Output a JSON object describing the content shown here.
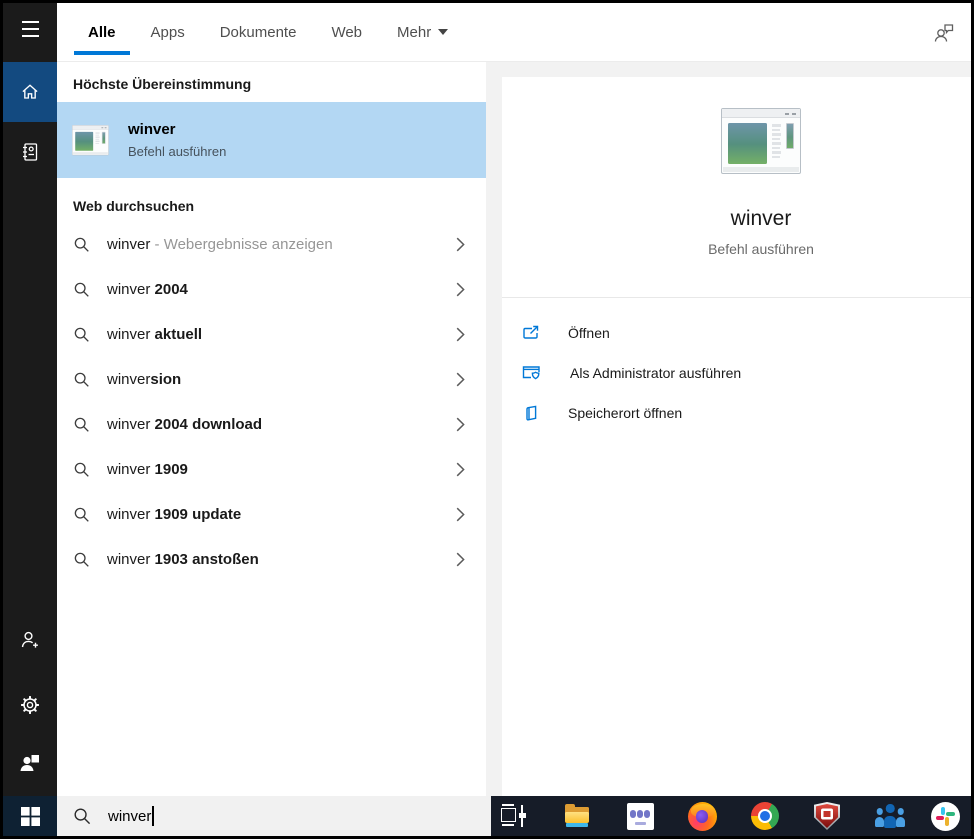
{
  "tabs": {
    "items": [
      "Alle",
      "Apps",
      "Dokumente",
      "Web",
      "Mehr"
    ],
    "active": "Alle"
  },
  "results": {
    "best_header": "Höchste Übereinstimmung",
    "best": {
      "title": "winver",
      "subtitle": "Befehl ausführen"
    },
    "web_header": "Web durchsuchen",
    "suggestions": [
      {
        "prefix": "winver",
        "suffix": " - Webergebnisse anzeigen",
        "style": "gray"
      },
      {
        "prefix": "winver",
        "suffix": " 2004",
        "style": "bold"
      },
      {
        "prefix": "winver",
        "suffix": " aktuell",
        "style": "bold"
      },
      {
        "prefix": "winver",
        "suffix": "sion",
        "style": "bold"
      },
      {
        "prefix": "winver",
        "suffix": " 2004 download",
        "style": "bold"
      },
      {
        "prefix": "winver",
        "suffix": " 1909",
        "style": "bold"
      },
      {
        "prefix": "winver",
        "suffix": " 1909 update",
        "style": "bold"
      },
      {
        "prefix": "winver",
        "suffix": " 1903 anstoßen",
        "style": "bold"
      }
    ]
  },
  "detail": {
    "title": "winver",
    "subtitle": "Befehl ausführen",
    "actions": [
      {
        "label": "Öffnen",
        "icon": "open-icon"
      },
      {
        "label": "Als Administrator ausführen",
        "icon": "admin-shield-icon"
      },
      {
        "label": "Speicherort öffnen",
        "icon": "file-location-icon"
      }
    ]
  },
  "taskbar": {
    "search_value": "winver",
    "icons": [
      "task-view",
      "file-explorer",
      "teams",
      "firefox",
      "chrome",
      "security-shield",
      "contacts",
      "slack"
    ]
  },
  "rail_icons": [
    "menu",
    "home",
    "journal",
    "add-user",
    "settings",
    "user-picture",
    "windows-start"
  ],
  "colors": {
    "accent": "#0078d7",
    "selection_blue": "#b3d7f3",
    "rail_active_blue": "#134a80",
    "taskbar_dark": "#161c28",
    "rail_dark": "#1b1b1b"
  }
}
